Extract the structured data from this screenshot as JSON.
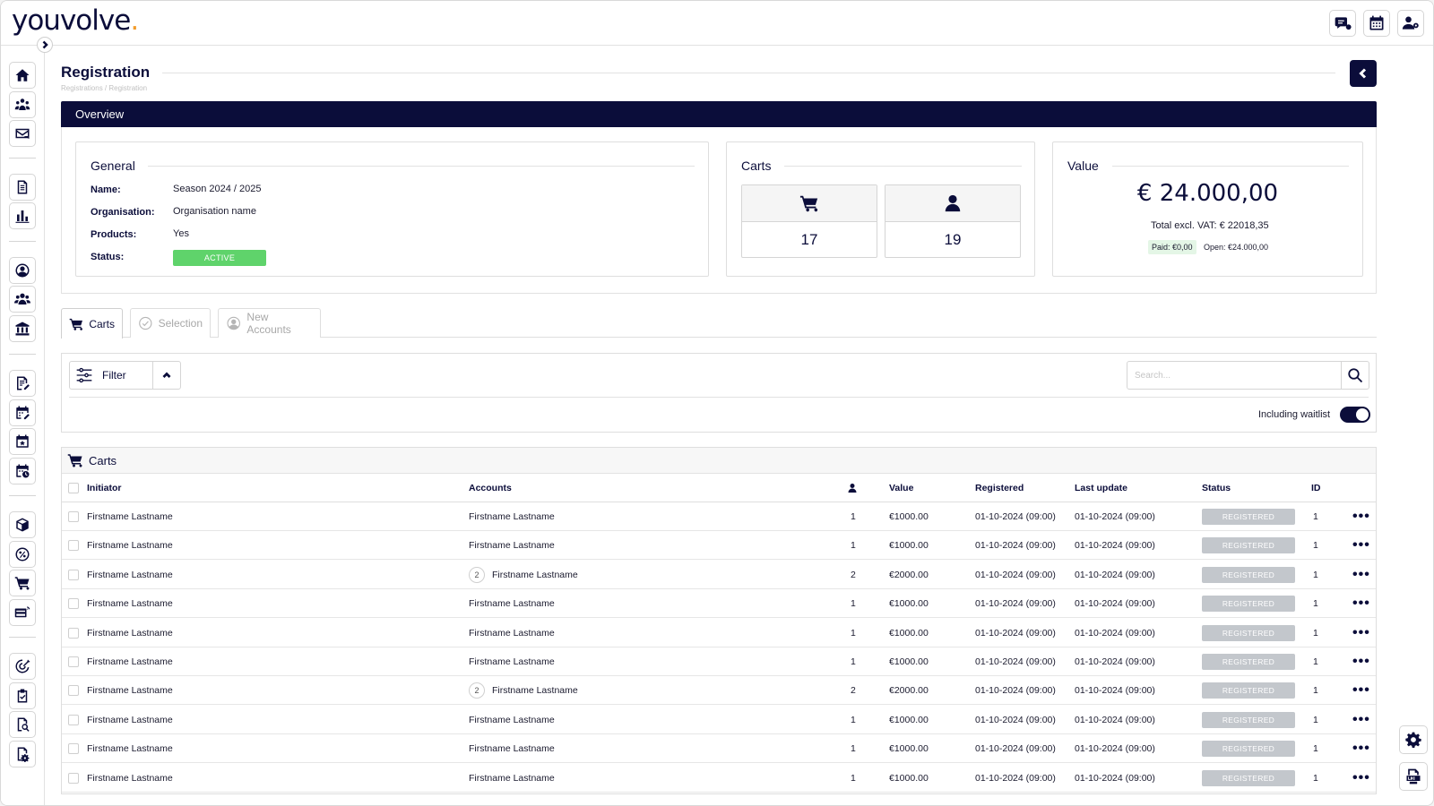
{
  "app": {
    "logo_text": "youvolve",
    "logo_dot": "."
  },
  "page": {
    "title": "Registration",
    "breadcrumb": "Registrations / Registration"
  },
  "overview": {
    "title": "Overview",
    "general": {
      "title": "General",
      "name_label": "Name:",
      "name_value": "Season 2024 / 2025",
      "organisation_label": "Organisation:",
      "organisation_value": "Organisation name",
      "products_label": "Products:",
      "products_value": "Yes",
      "status_label": "Status:",
      "status_value": "ACTIVE"
    },
    "carts": {
      "title": "Carts",
      "cart_count": "17",
      "person_count": "19"
    },
    "value": {
      "title": "Value",
      "amount": "€ 24.000,00",
      "total_excl": "Total excl. VAT: € 22018,35",
      "paid": "Paid: €0,00",
      "open": "Open: €24.000,00"
    }
  },
  "tabs": [
    {
      "label": "Carts",
      "active": true
    },
    {
      "label": "Selection",
      "active": false
    },
    {
      "label": "New Accounts",
      "active": false
    }
  ],
  "filter": {
    "label": "Filter",
    "search_placeholder": "Search...",
    "waitlist_label": "Including waitlist",
    "waitlist_on": true
  },
  "carts_table": {
    "title": "Carts",
    "columns": {
      "initiator": "Initiator",
      "accounts": "Accounts",
      "value": "Value",
      "registered": "Registered",
      "last_update": "Last update",
      "status": "Status",
      "id": "ID"
    },
    "rows": [
      {
        "initiator": "Firstname Lastname",
        "accounts": "Firstname Lastname",
        "account_count": "",
        "persons": "1",
        "value": "€1000.00",
        "registered": "01-10-2024 (09:00)",
        "last_update": "01-10-2024 (09:00)",
        "status": "REGISTERED",
        "id": "1"
      },
      {
        "initiator": "Firstname Lastname",
        "accounts": "Firstname Lastname",
        "account_count": "",
        "persons": "1",
        "value": "€1000.00",
        "registered": "01-10-2024 (09:00)",
        "last_update": "01-10-2024 (09:00)",
        "status": "REGISTERED",
        "id": "1"
      },
      {
        "initiator": "Firstname Lastname",
        "accounts": "Firstname Lastname",
        "account_count": "2",
        "persons": "2",
        "value": "€2000.00",
        "registered": "01-10-2024 (09:00)",
        "last_update": "01-10-2024 (09:00)",
        "status": "REGISTERED",
        "id": "1"
      },
      {
        "initiator": "Firstname Lastname",
        "accounts": "Firstname Lastname",
        "account_count": "",
        "persons": "1",
        "value": "€1000.00",
        "registered": "01-10-2024 (09:00)",
        "last_update": "01-10-2024 (09:00)",
        "status": "REGISTERED",
        "id": "1"
      },
      {
        "initiator": "Firstname Lastname",
        "accounts": "Firstname Lastname",
        "account_count": "",
        "persons": "1",
        "value": "€1000.00",
        "registered": "01-10-2024 (09:00)",
        "last_update": "01-10-2024 (09:00)",
        "status": "REGISTERED",
        "id": "1"
      },
      {
        "initiator": "Firstname Lastname",
        "accounts": "Firstname Lastname",
        "account_count": "",
        "persons": "1",
        "value": "€1000.00",
        "registered": "01-10-2024 (09:00)",
        "last_update": "01-10-2024 (09:00)",
        "status": "REGISTERED",
        "id": "1"
      },
      {
        "initiator": "Firstname Lastname",
        "accounts": "Firstname Lastname",
        "account_count": "2",
        "persons": "2",
        "value": "€2000.00",
        "registered": "01-10-2024 (09:00)",
        "last_update": "01-10-2024 (09:00)",
        "status": "REGISTERED",
        "id": "1"
      },
      {
        "initiator": "Firstname Lastname",
        "accounts": "Firstname Lastname",
        "account_count": "",
        "persons": "1",
        "value": "€1000.00",
        "registered": "01-10-2024 (09:00)",
        "last_update": "01-10-2024 (09:00)",
        "status": "REGISTERED",
        "id": "1"
      },
      {
        "initiator": "Firstname Lastname",
        "accounts": "Firstname Lastname",
        "account_count": "",
        "persons": "1",
        "value": "€1000.00",
        "registered": "01-10-2024 (09:00)",
        "last_update": "01-10-2024 (09:00)",
        "status": "REGISTERED",
        "id": "1"
      },
      {
        "initiator": "Firstname Lastname",
        "accounts": "Firstname Lastname",
        "account_count": "",
        "persons": "1",
        "value": "€1000.00",
        "registered": "01-10-2024 (09:00)",
        "last_update": "01-10-2024 (09:00)",
        "status": "REGISTERED",
        "id": "1"
      }
    ],
    "more_glyph": "•••"
  },
  "icons": {
    "top": [
      "notification-icon",
      "calendar-icon",
      "user-settings-icon"
    ],
    "sidebar": [
      "home-icon",
      "community-icon",
      "mail-icon",
      "document-icon",
      "chart-icon",
      "user-circle-icon",
      "users-icon",
      "bank-icon",
      "form-icon",
      "calendar-edit-icon",
      "calendar-star-icon",
      "calendar-clock-icon",
      "box-icon",
      "discount-icon",
      "cart-icon",
      "payment-icon",
      "target-icon",
      "clipboard-check-icon",
      "search-document-icon",
      "settings-document-icon"
    ],
    "right": [
      "gear-icon",
      "log-icon"
    ]
  },
  "colors": {
    "brand": "#0b0d3a",
    "accent": "#f29c2b",
    "active_status": "#5fd36b",
    "registered_status": "#c3c7cc"
  }
}
